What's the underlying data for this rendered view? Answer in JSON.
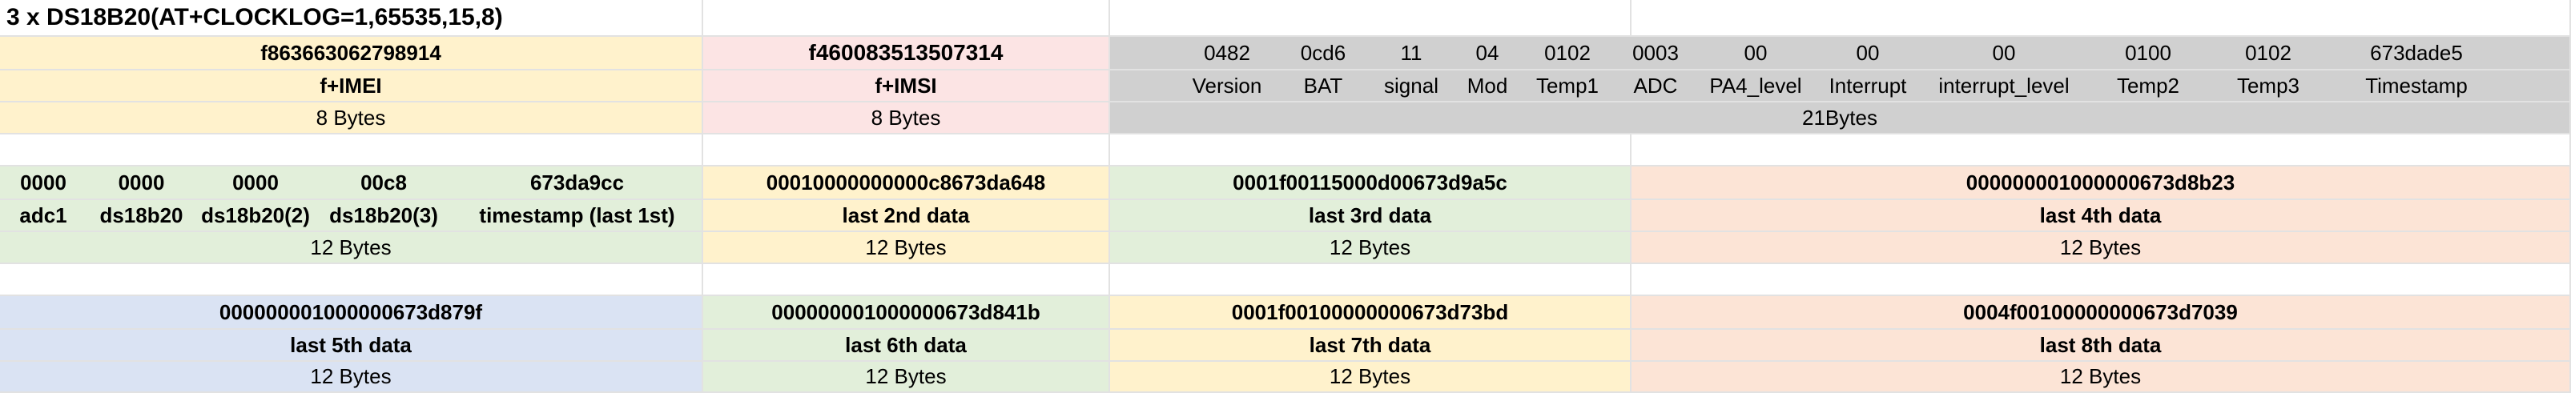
{
  "title": "3 x DS18B20(AT+CLOCKLOG=1,65535,15,8)",
  "header_block": {
    "imei_value": "f863663062798914",
    "imei_label": "f+IMEI",
    "imei_size": "8 Bytes",
    "imsi_value": "f460083513507314",
    "imsi_label": "f+IMSI",
    "imsi_size": "8 Bytes",
    "fields": [
      {
        "value": "0482",
        "label": "Version"
      },
      {
        "value": "0cd6",
        "label": "BAT"
      },
      {
        "value": "11",
        "label": "signal"
      },
      {
        "value": "04",
        "label": "Mod"
      },
      {
        "value": "0102",
        "label": "Temp1"
      },
      {
        "value": "0003",
        "label": "ADC"
      },
      {
        "value": "00",
        "label": "PA4_level"
      },
      {
        "value": "00",
        "label": "Interrupt"
      },
      {
        "value": "00",
        "label": "interrupt_level"
      },
      {
        "value": "0100",
        "label": "Temp2"
      },
      {
        "value": "0102",
        "label": "Temp3"
      },
      {
        "value": "673dade5",
        "label": "Timestamp"
      }
    ],
    "fields_size": "21Bytes"
  },
  "data_block_1": {
    "first": {
      "values": [
        "0000",
        "0000",
        "0000",
        "00c8",
        "673da9cc"
      ],
      "labels": [
        "adc1",
        "ds18b20",
        "ds18b20(2)",
        "ds18b20(3)",
        "timestamp (last 1st)"
      ],
      "size": "12 Bytes"
    },
    "second": {
      "value": "00010000000000c8673da648",
      "label": "last 2nd data",
      "size": "12 Bytes"
    },
    "third": {
      "value": "0001f00115000d00673d9a5c",
      "label": "last 3rd data",
      "size": "12 Bytes"
    },
    "fourth": {
      "value": "000000001000000673d8b23",
      "label": "last 4th data",
      "size": "12 Bytes"
    }
  },
  "data_block_2": {
    "fifth": {
      "value": "000000001000000673d879f",
      "label": "last 5th data",
      "size": "12 Bytes"
    },
    "sixth": {
      "value": "000000001000000673d841b",
      "label": "last 6th data",
      "size": "12 Bytes"
    },
    "seventh": {
      "value": "0001f00100000000673d73bd",
      "label": "last 7th data",
      "size": "12 Bytes"
    },
    "eighth": {
      "value": "0004f00100000000673d7039",
      "label": "last 8th data",
      "size": "12 Bytes"
    }
  },
  "colors": {
    "yellow": "#fff2cc",
    "pink": "#fce4e4",
    "gray": "#d0d0d0",
    "green": "#e2efda",
    "orange": "#fce4d6",
    "blue": "#dae3f3"
  }
}
